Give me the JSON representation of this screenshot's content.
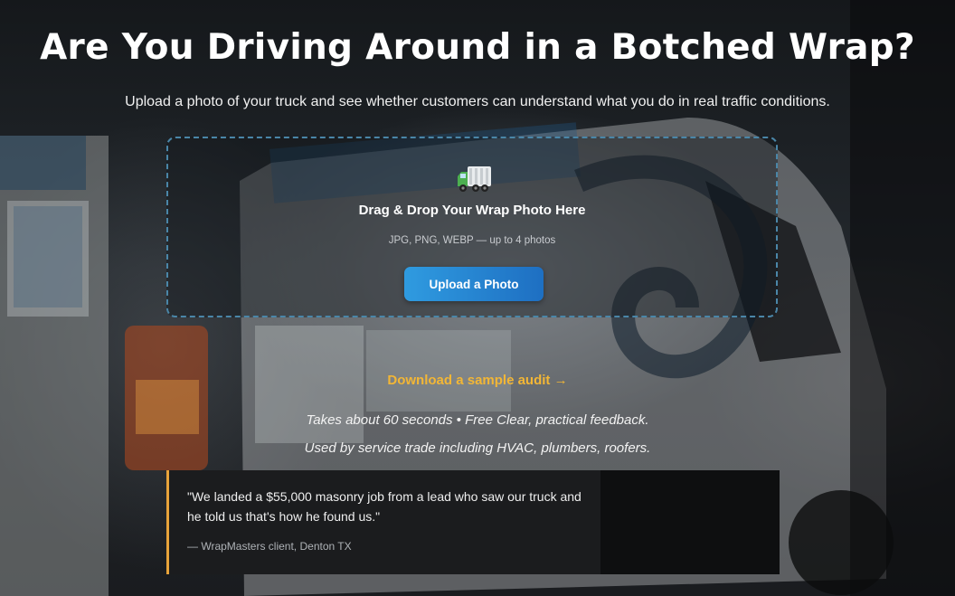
{
  "hero": {
    "title": "Are You Driving Around in a Botched Wrap?",
    "subtitle": "Upload a photo of your truck and see whether customers can understand what you do in real traffic conditions."
  },
  "dropzone": {
    "icon": "delivery-truck-icon",
    "title": "Drag & Drop Your Wrap Photo Here",
    "formats": "JPG, PNG, WEBP — up to 4 photos",
    "upload_label": "Upload a Photo"
  },
  "sample": {
    "label": "Download a sample audit →"
  },
  "meta": {
    "line1": "Takes about 60 seconds • Free Clear, practical feedback.",
    "line2": "Used by service trade including HVAC, plumbers, roofers."
  },
  "testimonial": {
    "quote": "\"We landed a $55,000 masonry job from a lead who saw our truck and he told us that's how he found us.\"",
    "attribution": "— WrapMasters client, Denton TX"
  },
  "colors": {
    "accent": "#f2b636",
    "button_start": "#2f9be0",
    "button_end": "#1e6fc2",
    "dropzone_border": "#4a86a8",
    "testimonial_bar": "#e8a33a"
  }
}
